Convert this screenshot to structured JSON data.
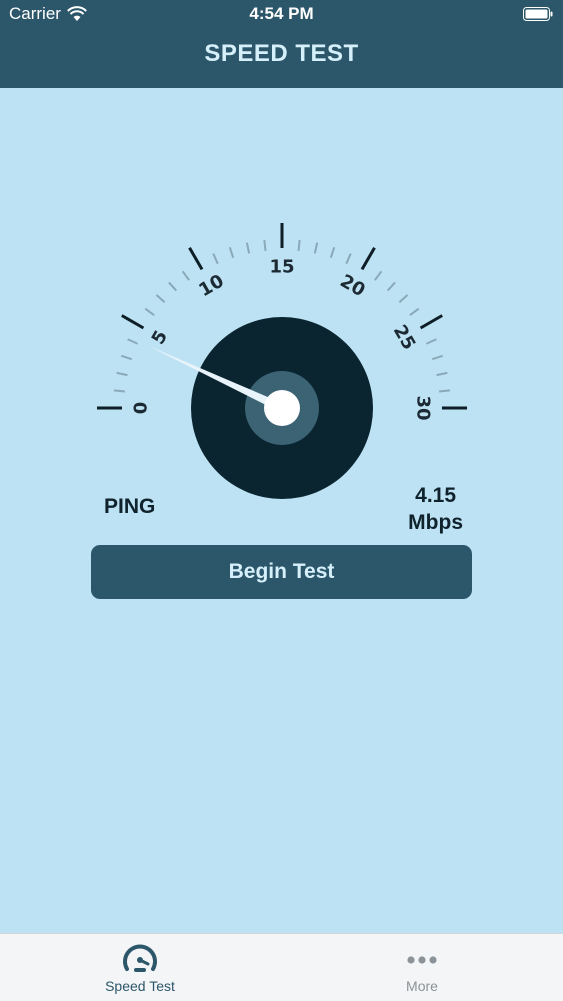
{
  "status_bar": {
    "carrier": "Carrier",
    "time": "4:54 PM"
  },
  "nav": {
    "title": "SPEED TEST"
  },
  "gauge": {
    "min": 0,
    "max": 30,
    "tick_labels": [
      "0",
      "5",
      "10",
      "15",
      "20",
      "25",
      "30"
    ],
    "needle_value": 4.15
  },
  "ping": {
    "label": "PING"
  },
  "speed": {
    "value": "4.15",
    "unit": "Mbps"
  },
  "begin_button": {
    "label": "Begin Test"
  },
  "tabs": [
    {
      "label": "Speed Test",
      "icon": "speedometer-icon",
      "selected": true
    },
    {
      "label": "More",
      "icon": "more-dots-icon",
      "selected": false
    }
  ],
  "colors": {
    "header": "#2c566a",
    "background": "#bde2f3",
    "dial": "#0a2430",
    "hub": "#3b6374"
  }
}
